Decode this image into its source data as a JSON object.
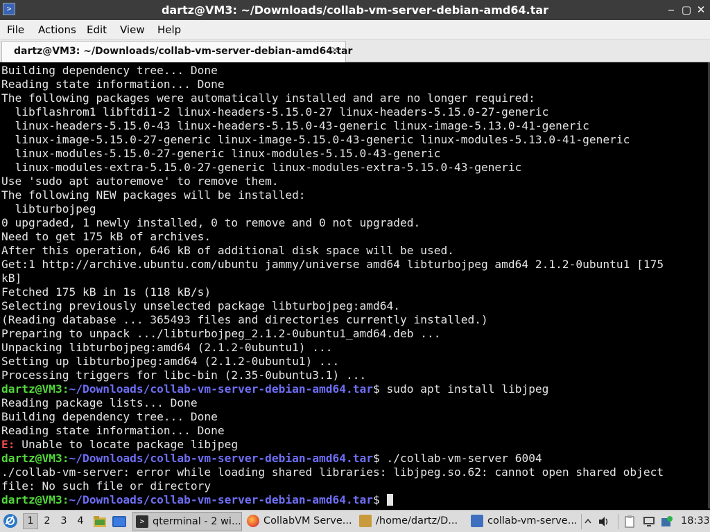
{
  "window": {
    "title": "dartz@VM3: ~/Downloads/collab-vm-server-debian-amd64.tar",
    "icon": "terminal-app-icon",
    "controls": {
      "minimize": "‒",
      "maximize": "▢",
      "close": "✕"
    }
  },
  "menu": [
    "File",
    "Actions",
    "Edit",
    "View",
    "Help"
  ],
  "tab": {
    "label": "dartz@VM3: ~/Downloads/collab-vm-server-debian-amd64.tar",
    "close": "✕"
  },
  "terminal": {
    "colors": {
      "background": "#000000",
      "text": "#e5e5e5",
      "user_host": "#54d93c",
      "path": "#6e6ef5",
      "error": "#f04a4a"
    },
    "prompt": {
      "user_host": "dartz@VM3",
      "path": "~/Downloads/collab-vm-server-debian-amd64.tar"
    },
    "lines": [
      {
        "text": "Building dependency tree... Done"
      },
      {
        "text": "Reading state information... Done"
      },
      {
        "text": "The following packages were automatically installed and are no longer required:"
      },
      {
        "text": "  libflashrom1 libftdi1-2 linux-headers-5.15.0-27 linux-headers-5.15.0-27-generic"
      },
      {
        "text": "  linux-headers-5.15.0-43 linux-headers-5.15.0-43-generic linux-image-5.13.0-41-generic"
      },
      {
        "text": "  linux-image-5.15.0-27-generic linux-image-5.15.0-43-generic linux-modules-5.13.0-41-generic"
      },
      {
        "text": "  linux-modules-5.15.0-27-generic linux-modules-5.15.0-43-generic"
      },
      {
        "text": "  linux-modules-extra-5.15.0-27-generic linux-modules-extra-5.15.0-43-generic"
      },
      {
        "text": "Use 'sudo apt autoremove' to remove them."
      },
      {
        "text": "The following NEW packages will be installed:"
      },
      {
        "text": "  libturbojpeg"
      },
      {
        "text": "0 upgraded, 1 newly installed, 0 to remove and 0 not upgraded."
      },
      {
        "text": "Need to get 175 kB of archives."
      },
      {
        "text": "After this operation, 646 kB of additional disk space will be used."
      },
      {
        "text": "Get:1 http://archive.ubuntu.com/ubuntu jammy/universe amd64 libturbojpeg amd64 2.1.2-0ubuntu1 [175"
      },
      {
        "text": "kB]"
      },
      {
        "text": "Fetched 175 kB in 1s (118 kB/s)"
      },
      {
        "text": "Selecting previously unselected package libturbojpeg:amd64."
      },
      {
        "text": "(Reading database ... 365493 files and directories currently installed.)"
      },
      {
        "text": "Preparing to unpack .../libturbojpeg_2.1.2-0ubuntu1_amd64.deb ..."
      },
      {
        "text": "Unpacking libturbojpeg:amd64 (2.1.2-0ubuntu1) ..."
      },
      {
        "text": "Setting up libturbojpeg:amd64 (2.1.2-0ubuntu1) ..."
      },
      {
        "text": "Processing triggers for libc-bin (2.35-0ubuntu3.1) ..."
      },
      {
        "prompt": true,
        "command": "sudo apt install libjpeg"
      },
      {
        "text": "Reading package lists... Done"
      },
      {
        "text": "Building dependency tree... Done"
      },
      {
        "text": "Reading state information... Done"
      },
      {
        "error_prefix": "E:",
        "text": " Unable to locate package libjpeg"
      },
      {
        "prompt": true,
        "command": "./collab-vm-server 6004"
      },
      {
        "text": "./collab-vm-server: error while loading shared libraries: libjpeg.so.62: cannot open shared object"
      },
      {
        "text": "file: No such file or directory"
      },
      {
        "prompt": true,
        "command": "",
        "cursor": true
      }
    ]
  },
  "taskbar": {
    "workspaces": [
      "1",
      "2",
      "3",
      "4"
    ],
    "active_workspace": "1",
    "apps": [
      {
        "label": "qterminal - 2 wi...",
        "icon": "terminal-icon"
      },
      {
        "label": "CollabVM Serve...",
        "icon": "firefox-icon"
      },
      {
        "label": "/home/dartz/D...",
        "icon": "file-manager-icon"
      },
      {
        "label": "collab-vm-serve...",
        "icon": "folder-icon"
      }
    ],
    "clock": "18:33"
  }
}
